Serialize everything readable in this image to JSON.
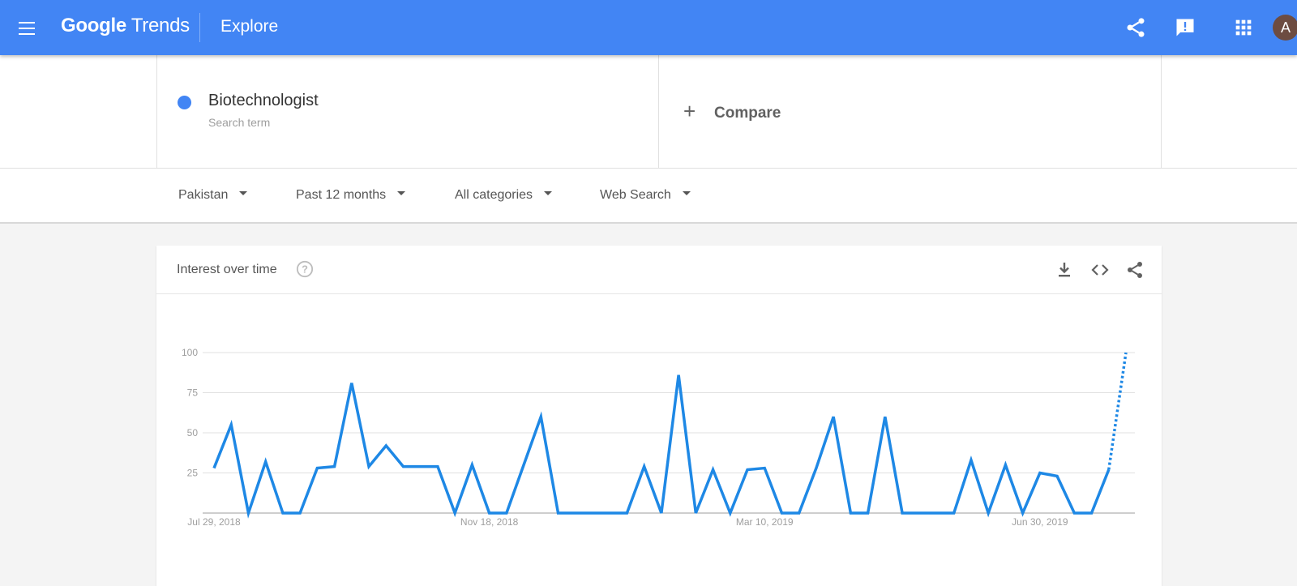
{
  "header": {
    "logo_google": "Google",
    "logo_trends": "Trends",
    "page_title": "Explore",
    "avatar_letter": "A",
    "bar_color": "#4285f4"
  },
  "search": {
    "term": "Biotechnologist",
    "term_type": "Search term",
    "term_color": "#4285f4",
    "compare_label": "Compare"
  },
  "filters": {
    "region": "Pakistan",
    "time_range": "Past 12 months",
    "category": "All categories",
    "property": "Web Search"
  },
  "chart_card": {
    "title": "Interest over time"
  },
  "chart_data": {
    "type": "line",
    "title": "Interest over time",
    "xlabel": "",
    "ylabel": "",
    "ylim": [
      0,
      100
    ],
    "yticks": [
      100,
      75,
      50,
      25
    ],
    "xtick_labels": [
      "Jul 29, 2018",
      "Nov 18, 2018",
      "Mar 10, 2019",
      "Jun 30, 2019"
    ],
    "xtick_indices": [
      0,
      16,
      32,
      48
    ],
    "grid": true,
    "line_color": "#1e88e5",
    "series": [
      {
        "name": "Biotechnologist",
        "values": [
          28,
          55,
          0,
          32,
          0,
          0,
          28,
          29,
          81,
          29,
          42,
          29,
          29,
          29,
          0,
          30,
          0,
          0,
          30,
          60,
          0,
          0,
          0,
          0,
          0,
          29,
          0,
          86,
          0,
          27,
          0,
          27,
          28,
          0,
          0,
          28,
          60,
          0,
          0,
          60,
          0,
          0,
          0,
          0,
          33,
          0,
          30,
          0,
          25,
          23,
          0,
          0,
          27,
          100
        ],
        "partial_from_index": 52
      }
    ]
  }
}
